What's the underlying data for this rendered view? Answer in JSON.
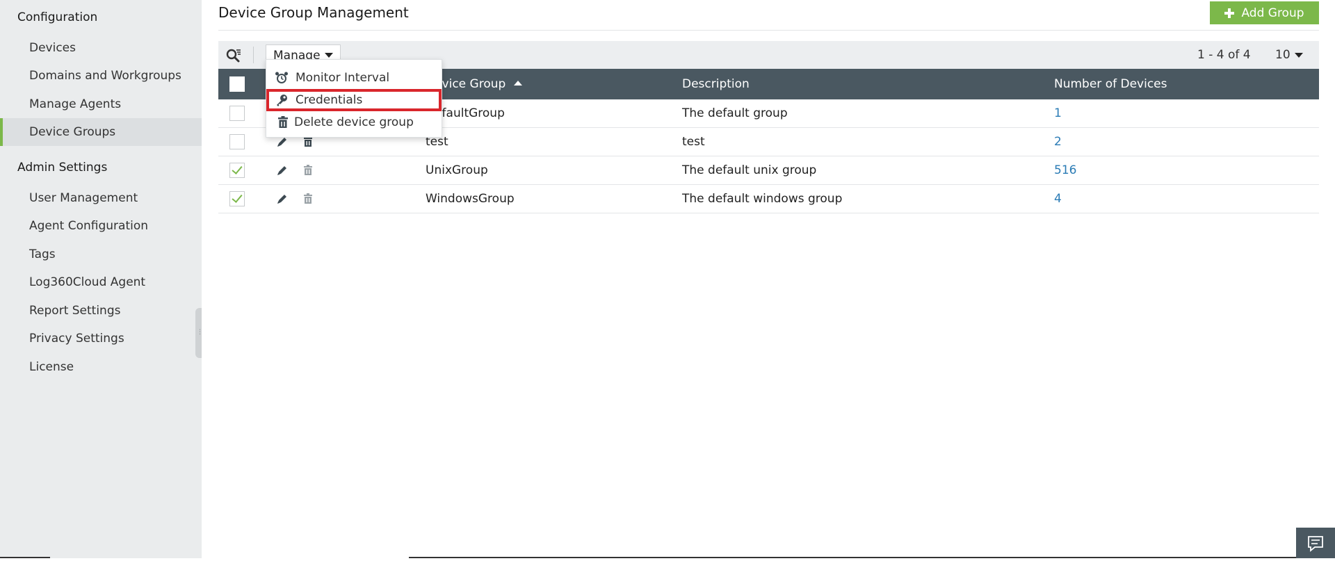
{
  "sidebar": {
    "sections": [
      {
        "title": "Configuration",
        "items": [
          {
            "label": "Devices",
            "active": false
          },
          {
            "label": "Domains and Workgroups",
            "active": false
          },
          {
            "label": "Manage Agents",
            "active": false
          },
          {
            "label": "Device Groups",
            "active": true
          }
        ]
      },
      {
        "title": "Admin Settings",
        "items": [
          {
            "label": "User Management",
            "active": false
          },
          {
            "label": "Agent Configuration",
            "active": false
          },
          {
            "label": "Tags",
            "active": false
          },
          {
            "label": "Log360Cloud Agent",
            "active": false
          },
          {
            "label": "Report Settings",
            "active": false
          },
          {
            "label": "Privacy Settings",
            "active": false
          },
          {
            "label": "License",
            "active": false
          }
        ]
      }
    ]
  },
  "header": {
    "title": "Device Group Management",
    "add_button_label": "Add Group"
  },
  "toolbar": {
    "search_icon": "search-filter-icon",
    "manage_label": "Manage",
    "pagination": "1 - 4 of 4",
    "page_size": "10"
  },
  "manage_menu": {
    "items": [
      {
        "label": "Monitor Interval",
        "icon": "alarm-clock-icon"
      },
      {
        "label": "Credentials",
        "icon": "key-icon",
        "highlighted": true
      },
      {
        "label": "Delete device group",
        "icon": "trash-icon"
      }
    ]
  },
  "table": {
    "columns": {
      "group": "Device Group",
      "description": "Description",
      "count": "Number of Devices"
    },
    "rows": [
      {
        "group": "DefaultGroup",
        "description": "The default group",
        "count": "1",
        "checked": false
      },
      {
        "group": "test",
        "description": "test",
        "count": "2",
        "checked": false
      },
      {
        "group": "UnixGroup",
        "description": "The default unix group",
        "count": "516",
        "checked": true
      },
      {
        "group": "WindowsGroup",
        "description": "The default windows group",
        "count": "4",
        "checked": true
      }
    ]
  },
  "colors": {
    "accent_green": "#7cb84a",
    "table_header": "#4a5861",
    "link_blue": "#2a7bb5",
    "highlight_red": "#d9262c"
  }
}
